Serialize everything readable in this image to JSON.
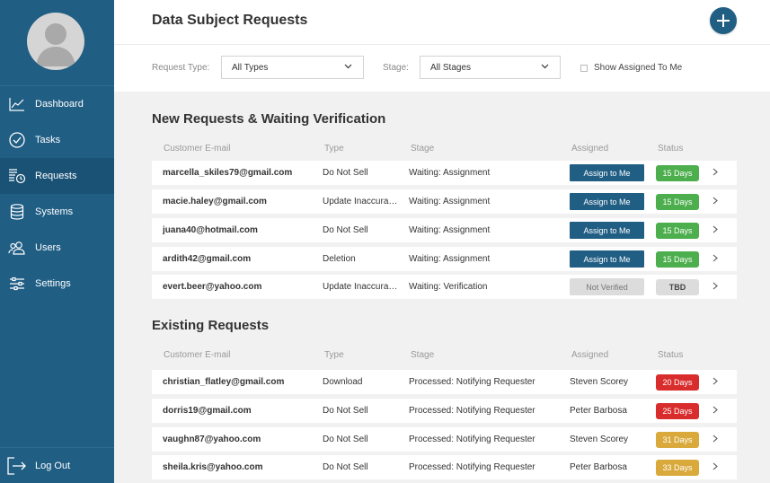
{
  "colors": {
    "sidebar": "#205e84",
    "primary": "#205e84",
    "green": "#4cae4c",
    "red": "#d92d2d",
    "gold": "#d9a93b",
    "gray": "#dcdcdc"
  },
  "sidebar": {
    "avatar_icon": "user-silhouette-icon",
    "items": [
      {
        "label": "Dashboard",
        "icon": "line-chart-icon"
      },
      {
        "label": "Tasks",
        "icon": "check-circle-icon"
      },
      {
        "label": "Requests",
        "icon": "requests-icon",
        "active": true
      },
      {
        "label": "Systems",
        "icon": "database-icon"
      },
      {
        "label": "Users",
        "icon": "users-icon"
      },
      {
        "label": "Settings",
        "icon": "sliders-icon"
      }
    ],
    "logout_label": "Log Out"
  },
  "header": {
    "title": "Data Subject Requests",
    "add_icon": "plus-icon"
  },
  "filters": {
    "request_type_label": "Request Type:",
    "request_type_value": "All Types",
    "stage_label": "Stage:",
    "stage_value": "All Stages",
    "show_assigned_label": "Show Assigned To Me",
    "show_assigned_checked": false
  },
  "columns": {
    "email": "Customer E-mail",
    "type": "Type",
    "stage": "Stage",
    "assigned": "Assigned",
    "status": "Status"
  },
  "new_requests": {
    "title": "New Requests & Waiting Verification",
    "rows": [
      {
        "email": "marcella_skiles79@gmail.com",
        "type": "Do Not Sell",
        "stage": "Waiting: Assignment",
        "assigned": "Assign to Me",
        "status": "15 Days",
        "status_color": "#4cae4c"
      },
      {
        "email": "macie.haley@gmail.com",
        "type": "Update Inaccurate Data",
        "stage": "Waiting: Assignment",
        "assigned": "Assign to Me",
        "status": "15 Days",
        "status_color": "#4cae4c"
      },
      {
        "email": "juana40@hotmail.com",
        "type": "Do Not Sell",
        "stage": "Waiting: Assignment",
        "assigned": "Assign to Me",
        "status": "15 Days",
        "status_color": "#4cae4c"
      },
      {
        "email": "ardith42@gmail.com",
        "type": "Deletion",
        "stage": "Waiting: Assignment",
        "assigned": "Assign to Me",
        "status": "15 Days",
        "status_color": "#4cae4c"
      },
      {
        "email": "evert.beer@yahoo.com",
        "type": "Update Inaccurate Data",
        "stage": "Waiting: Verification",
        "assigned": "Not Verified",
        "status": "TBD",
        "status_color": "#dcdcdc"
      }
    ]
  },
  "existing_requests": {
    "title": "Existing Requests",
    "rows": [
      {
        "email": "christian_flatley@gmail.com",
        "type": "Download",
        "stage": "Processed: Notifying Requester",
        "assigned": "Steven Scorey",
        "status": "20 Days",
        "status_color": "#d92d2d"
      },
      {
        "email": "dorris19@gmail.com",
        "type": "Do Not Sell",
        "stage": "Processed: Notifying Requester",
        "assigned": "Peter Barbosa",
        "status": "25 Days",
        "status_color": "#d92d2d"
      },
      {
        "email": "vaughn87@yahoo.com",
        "type": "Do Not Sell",
        "stage": "Processed: Notifying Requester",
        "assigned": "Steven Scorey",
        "status": "31 Days",
        "status_color": "#d9a93b"
      },
      {
        "email": "sheila.kris@yahoo.com",
        "type": "Do Not Sell",
        "stage": "Processed: Notifying Requester",
        "assigned": "Peter Barbosa",
        "status": "33 Days",
        "status_color": "#d9a93b"
      }
    ]
  }
}
